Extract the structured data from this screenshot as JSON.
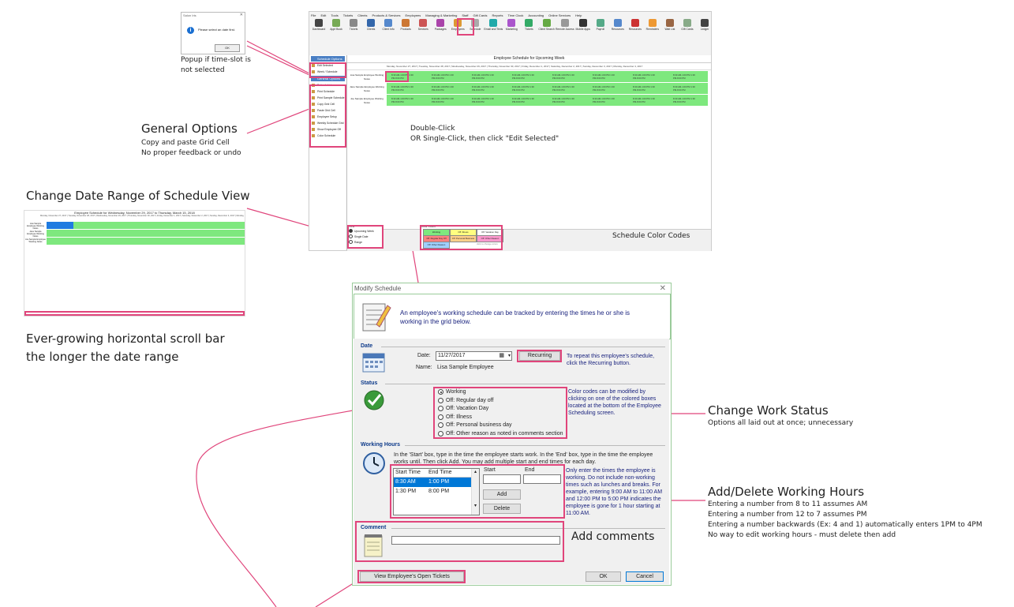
{
  "annotations": {
    "popup_note_line1": "Popup if time-slot is",
    "popup_note_line2": "not selected",
    "general_title": "General Options",
    "general_line1": "Copy and paste Grid Cell",
    "general_line2": "No proper feedback or undo",
    "date_range_title": "Change Date Range of Schedule View",
    "scroll_line1": "Ever-growing horizontal scroll bar",
    "scroll_line2": "the longer the date range",
    "double_click_line1": "Double-Click",
    "double_click_line2": "OR Single-Click, then click \"Edit Selected\"",
    "color_codes": "Schedule Color Codes",
    "work_status_title": "Change Work Status",
    "work_status_sub": "Options all laid out at once; unnecessary",
    "working_hours_title": "Add/Delete Working Hours",
    "working_hours_notes": [
      "Entering a number from 8 to 11 assumes AM",
      "Entering a number from 12 to 7 assumes PM",
      "Entering a number backwards (Ex: 4 and 1) automatically enters 1PM to 4PM",
      "No way to edit working hours - must delete then add"
    ],
    "comments_note": "Add comments"
  },
  "popup": {
    "title": "Salon Iris",
    "message": "Please select an date first.",
    "ok": "OK"
  },
  "app": {
    "menu": [
      "File",
      "Edit",
      "Tools",
      "Tickets",
      "Clients",
      "Products & Services",
      "Employees",
      "Managing & Marketing",
      "Staff",
      "Gift Cards",
      "Reports",
      "Time Clock",
      "Accounting",
      "Online Services",
      "Help"
    ],
    "toolbar": [
      {
        "label": "Dashboard",
        "color": "#444"
      },
      {
        "label": "Appt Book",
        "color": "#7a5"
      },
      {
        "label": "Tickets",
        "color": "#888"
      },
      {
        "label": "Clients",
        "color": "#36a"
      },
      {
        "label": "Client Info",
        "color": "#58c"
      },
      {
        "label": "Products",
        "color": "#c73"
      },
      {
        "label": "Services",
        "color": "#c55"
      },
      {
        "label": "Packages",
        "color": "#a4a"
      },
      {
        "label": "Employees",
        "color": "#d93"
      },
      {
        "label": "Schedule",
        "color": "#aaa"
      },
      {
        "label": "Email and Texts",
        "color": "#2aa"
      },
      {
        "label": "Marketing",
        "color": "#a5c"
      },
      {
        "label": "Tickets",
        "color": "#3a6"
      },
      {
        "label": "Client Search",
        "color": "#6a4"
      },
      {
        "label": "Remote Access",
        "color": "#999"
      },
      {
        "label": "Mobile Apps",
        "color": "#333"
      },
      {
        "label": "Payroll",
        "color": "#5a8"
      },
      {
        "label": "Resources",
        "color": "#58c"
      },
      {
        "label": "Resources",
        "color": "#c33"
      },
      {
        "label": "Reminders",
        "color": "#e93"
      },
      {
        "label": "Wait List",
        "color": "#964"
      },
      {
        "label": "Gift Cards",
        "color": "#8a8"
      },
      {
        "label": "Ledger",
        "color": "#444"
      }
    ],
    "schedule_title": "Employee Schedule for Upcoming Week",
    "schedule_header": "Monday, November 27, 2017 | Tuesday, November 28, 2017 | Wednesday, November 29, 2017 | Thursday, November 30, 2017 | Friday, December 1, 2017 | Saturday, December 2, 2017 | Sunday, December 3, 2017 | Monday, December 4, 2017",
    "employees": [
      "Lisa Sample Employee Working Notes",
      "Jane Sample Employee Working Notes",
      "Joe Sample Employee Working Notes"
    ],
    "cell_text": "8:30 AM-1:00 PM 1:30 PM-8:00 PM",
    "left_section1": "Schedule Options",
    "left_items1": [
      "Edit Selected",
      "Week / Schedule"
    ],
    "left_section2": "General Options",
    "left_items2": [
      "Refresh List",
      "Print Schedule",
      "Print Sample Schedule",
      "Copy Grid Cell",
      "Paste Grid Cell",
      "Employee Setup",
      "Weekly Schedule Grid",
      "Show Employee Off",
      "Color Schedule"
    ],
    "view_heading": "View",
    "view_options": [
      "Upcoming Week",
      "Single Date",
      "Range"
    ],
    "color_heading": "Color Codes",
    "color_boxes": [
      {
        "label": "Working",
        "color": "#7ee87e"
      },
      {
        "label": "Off: Illness",
        "color": "#ffff80"
      },
      {
        "label": "Off: Vacation Day",
        "color": "#ffffff"
      },
      {
        "label": "Off: Regular Day Off",
        "color": "#ff8080"
      },
      {
        "label": "Off: Personal Business",
        "color": "#ffd08a"
      },
      {
        "label": "Off: Other Reason",
        "color": "#ff9ad0"
      },
      {
        "label": "Off: Other Reason",
        "color": "#9fd0ff"
      }
    ],
    "color_hint": "click to change colors"
  },
  "range_view": {
    "title": "Employee Schedule for Wednesday, November 29, 2017 to Thursday, March 15, 2018"
  },
  "dialog": {
    "title": "Modify Schedule",
    "close": "✕",
    "banner_text": "An employee's working schedule can be tracked by entering the times he or she is working in the grid below.",
    "date_section": "Date",
    "date_label": "Date:",
    "date_value": "11/27/2017",
    "name_label": "Name:",
    "name_value": "Lisa Sample Employee",
    "recurring_button": "Recurring",
    "recurring_hint": "To repeat this employee's schedule, click the Recurring button.",
    "status_section": "Status",
    "status_options": [
      "Working",
      "Off: Regular day off",
      "Off: Vacation Day",
      "Off: Illness",
      "Off: Personal business day",
      "Off: Other reason as noted in comments section"
    ],
    "status_selected": 0,
    "status_hint": "Color codes can be modified by clicking on one of the colored boxes located at the bottom of the Employee Scheduling screen.",
    "hours_section": "Working Hours",
    "hours_instructions": "In the 'Start' box, type in the time the employee starts work. In the 'End' box, type in the time the employee works until. Then click Add. You may add multiple start and end times for each day.",
    "col_start": "Start Time",
    "col_end": "End Time",
    "rows": [
      {
        "start": "8:30 AM",
        "end": "1:00 PM"
      },
      {
        "start": "1:30 PM",
        "end": "8:00 PM"
      }
    ],
    "start_label": "Start",
    "end_label": "End",
    "add_button": "Add",
    "delete_button": "Delete",
    "hours_hint": "Only enter the times the employee is working. Do not include non-working times such as lunches and breaks. For example, entering 9:00 AM to 11:00 AM and 12:00 PM to 5:00 PM indicates the employee is gone for 1 hour starting at 11:00 AM.",
    "comment_section": "Comment",
    "view_tickets_button": "View Employee's Open Tickets",
    "ok_button": "OK",
    "cancel_button": "Cancel"
  }
}
